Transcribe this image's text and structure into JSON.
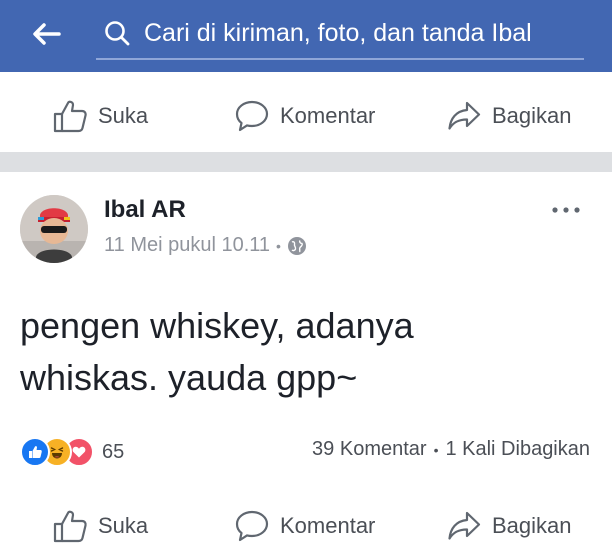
{
  "header": {
    "search_placeholder": "Cari di kiriman, foto, dan tanda Ibal"
  },
  "top_actions": {
    "like": "Suka",
    "comment": "Komentar",
    "share": "Bagikan"
  },
  "post": {
    "author": "Ibal AR",
    "timestamp": "11 Mei pukul 10.11",
    "privacy_icon": "globe-icon",
    "text": "pengen whiskey, adanya\nwhiskas. yauda gpp~",
    "reactions": {
      "types": [
        "like",
        "haha",
        "love"
      ],
      "count": "65"
    },
    "comments_count": "39 Komentar",
    "shares_count": "1 Kali Dibagikan"
  },
  "bottom_actions": {
    "like": "Suka",
    "comment": "Komentar",
    "share": "Bagikan"
  },
  "colors": {
    "header_bg": "#4267b2",
    "separator": "#dddfe2",
    "like_blue": "#1877f2",
    "haha_yellow": "#f7b125",
    "love_red": "#f25268"
  }
}
